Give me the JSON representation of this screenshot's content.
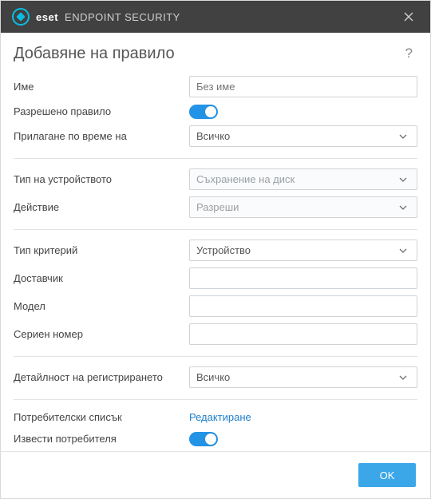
{
  "titlebar": {
    "brand1": "eset",
    "brand2": "ENDPOINT SECURITY"
  },
  "heading": "Добавяне на правило",
  "labels": {
    "name": "Име",
    "rule_enabled": "Разрешено правило",
    "apply_during": "Прилагане по време на",
    "device_type": "Тип на устройството",
    "action": "Действие",
    "criteria_type": "Тип критерий",
    "vendor": "Доставчик",
    "model": "Модел",
    "serial": "Сериен номер",
    "logging_severity": "Детайлност на регистрирането",
    "user_list": "Потребителски списък",
    "notify_user": "Извести потребителя"
  },
  "values": {
    "name_placeholder": "Без име",
    "apply_during": "Всичко",
    "device_type": "Съхранение на диск",
    "action": "Разреши",
    "criteria_type": "Устройство",
    "vendor": "",
    "model": "",
    "serial": "",
    "logging_severity": "Всичко",
    "user_list_action": "Редактиране"
  },
  "footer": {
    "ok": "OK"
  }
}
